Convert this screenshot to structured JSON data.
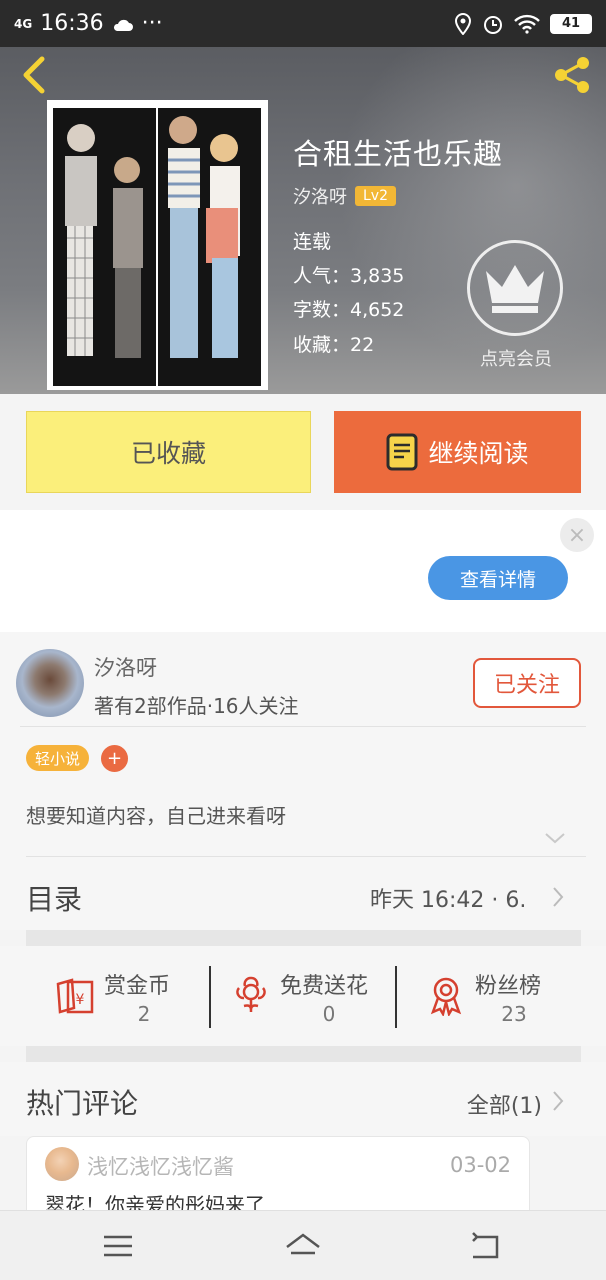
{
  "status_bar": {
    "network": "4G",
    "time": "16:36",
    "more": "···",
    "battery": "41"
  },
  "book": {
    "title": "合租生活也乐趣",
    "author": "汐洛呀",
    "level": "Lv2",
    "status": "连载",
    "popularity": "人气：3,835",
    "word_count": "字数：4,652",
    "favorites": "收藏：22"
  },
  "vip": {
    "label": "点亮会员"
  },
  "actions": {
    "favorited_label": "已收藏",
    "continue_label": "继续阅读"
  },
  "ad": {
    "close_glyph": "×",
    "detail_label": "查看详情"
  },
  "author_card": {
    "name": "汐洛呀",
    "subtitle": "著有2部作品·16人关注",
    "follow_label": "已关注",
    "tag": "轻小说",
    "tag_add": "+",
    "description": "想要知道内容，自己进来看呀"
  },
  "toc": {
    "title": "目录",
    "update": "昨天 16:42 · 6."
  },
  "stats": [
    {
      "label": "赏金币",
      "value": "2",
      "icon": "red-envelope-icon"
    },
    {
      "label": "免费送花",
      "value": "0",
      "icon": "flower-icon"
    },
    {
      "label": "粉丝榜",
      "value": "23",
      "icon": "medal-icon"
    }
  ],
  "comments": {
    "title": "热门评论",
    "all_label": "全部(1)",
    "items": [
      {
        "user": "浅忆浅忆浅忆酱",
        "date": "03-02",
        "text": "翠花！你亲爱的彤妈来了"
      }
    ]
  },
  "colors": {
    "accent_orange": "#ec6b3d",
    "favorite_yellow": "#fbef7b",
    "ad_blue": "#4a96e4",
    "level_badge": "#f2b736",
    "stat_icon_red": "#d5402f"
  }
}
